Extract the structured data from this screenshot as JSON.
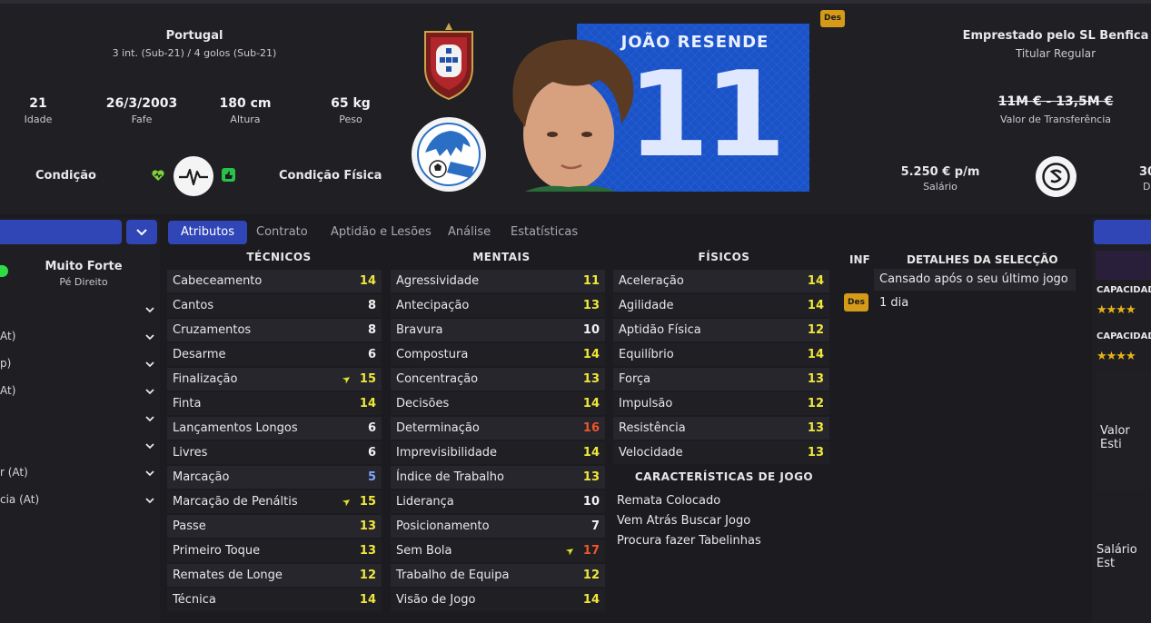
{
  "header": {
    "nation": "Portugal",
    "caps": "3 int. (Sub-21) / 4 golos (Sub-21)",
    "age_value": "21",
    "age_label": "Idade",
    "dob_value": "26/3/2003",
    "dob_label": "Fafe",
    "height_value": "180 cm",
    "height_label": "Altura",
    "weight_value": "65 kg",
    "weight_label": "Peso",
    "condition_label": "Condição",
    "fitness_label": "Condição Física",
    "loan_status": "Emprestado pelo SL Benfica",
    "squad_status": "Titular Regular",
    "transfer_value": "11M € - 13,5M €",
    "transfer_label": "Valor de Transferência",
    "wage_value": "5.250 € p/m",
    "wage_label": "Salário",
    "wage_cut": "30",
    "wage_cut_label": "D",
    "shirt_name": "JOÃO RESENDE",
    "shirt_number": "11",
    "des_badge": "Des"
  },
  "left_panel": {
    "foot_strength": "Muito Forte",
    "foot_label": "Pé Direito",
    "dropdown_labels": [
      "At)",
      "p)",
      "At)",
      "",
      "",
      "r (At)",
      "cia (At)"
    ]
  },
  "tabs": [
    "Atributos",
    "Contrato",
    "Aptidão e Lesões",
    "Análise",
    "Estatísticas"
  ],
  "technical": {
    "title": "TÉCNICOS",
    "rows": [
      {
        "name": "Cabeceamento",
        "value": "14"
      },
      {
        "name": "Cantos",
        "value": "8"
      },
      {
        "name": "Cruzamentos",
        "value": "8"
      },
      {
        "name": "Desarme",
        "value": "6"
      },
      {
        "name": "Finalização",
        "value": "15"
      },
      {
        "name": "Finta",
        "value": "14"
      },
      {
        "name": "Lançamentos Longos",
        "value": "6"
      },
      {
        "name": "Livres",
        "value": "6"
      },
      {
        "name": "Marcação",
        "value": "5"
      },
      {
        "name": "Marcação de Penáltis",
        "value": "15"
      },
      {
        "name": "Passe",
        "value": "13"
      },
      {
        "name": "Primeiro Toque",
        "value": "13"
      },
      {
        "name": "Remates de Longe",
        "value": "12"
      },
      {
        "name": "Técnica",
        "value": "14"
      }
    ]
  },
  "mental": {
    "title": "MENTAIS",
    "rows": [
      {
        "name": "Agressividade",
        "value": "11"
      },
      {
        "name": "Antecipação",
        "value": "13"
      },
      {
        "name": "Bravura",
        "value": "10"
      },
      {
        "name": "Compostura",
        "value": "14"
      },
      {
        "name": "Concentração",
        "value": "13"
      },
      {
        "name": "Decisões",
        "value": "14"
      },
      {
        "name": "Determinação",
        "value": "16"
      },
      {
        "name": "Imprevisibilidade",
        "value": "14"
      },
      {
        "name": "Índice de Trabalho",
        "value": "13"
      },
      {
        "name": "Liderança",
        "value": "10"
      },
      {
        "name": "Posicionamento",
        "value": "7"
      },
      {
        "name": "Sem Bola",
        "value": "17"
      },
      {
        "name": "Trabalho de Equipa",
        "value": "12"
      },
      {
        "name": "Visão de Jogo",
        "value": "14"
      }
    ]
  },
  "physical": {
    "title": "FÍSICOS",
    "rows": [
      {
        "name": "Aceleração",
        "value": "14"
      },
      {
        "name": "Agilidade",
        "value": "14"
      },
      {
        "name": "Aptidão Física",
        "value": "12"
      },
      {
        "name": "Equilíbrio",
        "value": "14"
      },
      {
        "name": "Força",
        "value": "13"
      },
      {
        "name": "Impulsão",
        "value": "12"
      },
      {
        "name": "Resistência",
        "value": "13"
      },
      {
        "name": "Velocidade",
        "value": "13"
      }
    ]
  },
  "traits": {
    "title": "CARACTERÍSTICAS DE JOGO",
    "items": [
      "Remata Colocado",
      "Vem Atrás Buscar Jogo",
      "Procura fazer Tabelinhas"
    ]
  },
  "selection": {
    "inf_label": "INF",
    "title": "DETALHES DA SELECÇÃO",
    "line1": "Cansado após o seu último jogo",
    "line2": "1 dia",
    "badge": "Des"
  },
  "right_panel": {
    "cap1": "CAPACIDAD",
    "cap2": "CAPACIDAD",
    "value_label": "Valor Esti",
    "wage_label": "Salário Est"
  },
  "colors": {
    "accent": "#3046b6",
    "yellow": "#f1e83a",
    "red": "#f0552a",
    "badge": "#d59a17",
    "shirt": "#1a52c7"
  }
}
